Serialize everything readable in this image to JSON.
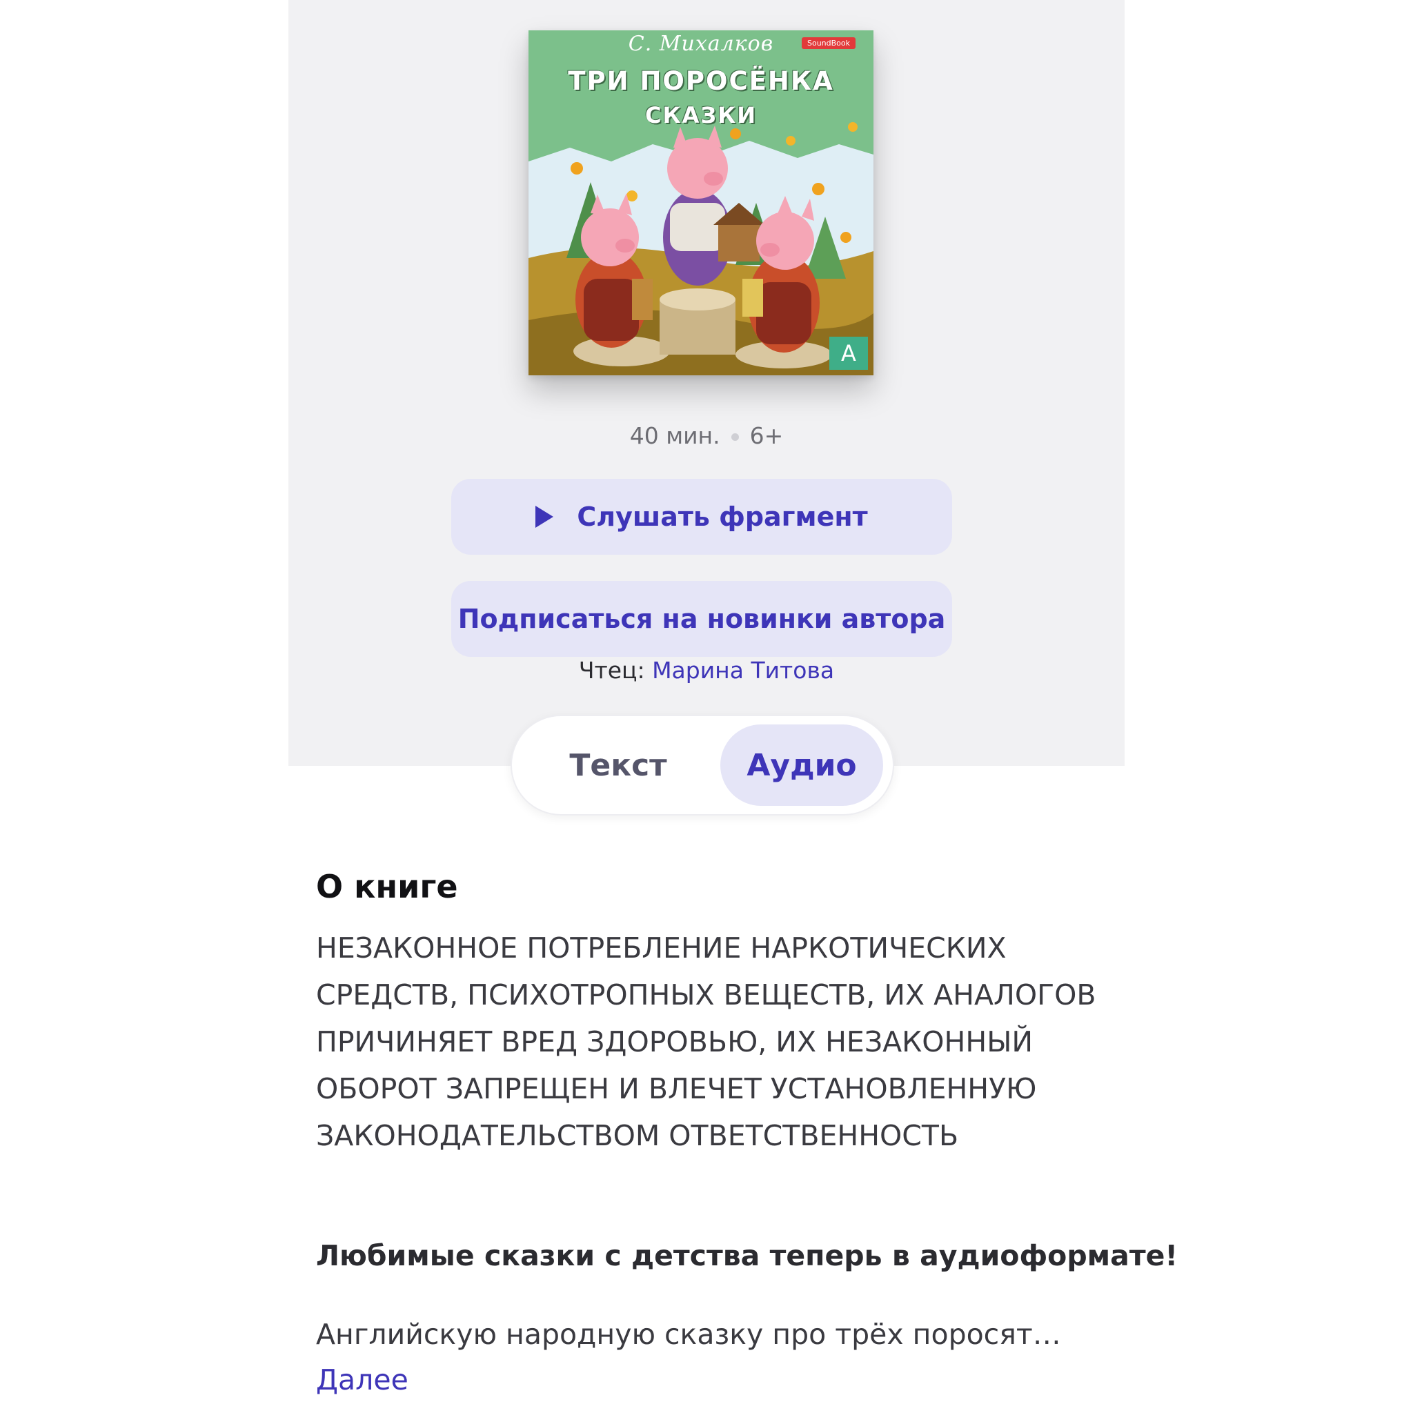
{
  "cover": {
    "author": "С. Михалков",
    "publisher": "SoundBook",
    "title": "ТРИ ПОРОСЁНКА",
    "subtitle": "СКАЗКИ",
    "corner_mark": "А"
  },
  "meta": {
    "duration": "40 мин.",
    "age_rating": "6+"
  },
  "actions": {
    "listen_label": "Слушать фрагмент",
    "subscribe_label": "Подписаться на новинки автора"
  },
  "reader": {
    "label": "Чтец:",
    "name": "Марина Титова"
  },
  "format_tabs": {
    "text_label": "Текст",
    "audio_label": "Аудио",
    "selected": "Аудио"
  },
  "about": {
    "heading": "О книге",
    "warning": "НЕЗАКОННОЕ ПОТРЕБЛЕНИЕ НАРКОТИЧЕСКИХ СРЕДСТВ, ПСИХОТРОПНЫХ ВЕЩЕСТВ, ИХ АНАЛОГОВ ПРИЧИНЯЕТ ВРЕД ЗДОРОВЬЮ, ИХ НЕЗАКОННЫЙ ОБОРОТ ЗАПРЕЩЕН И ВЛЕЧЕТ УСТАНОВЛЕННУЮ ЗАКОНОДАТЕЛЬСТВОМ ОТВЕТСТВЕННОСТЬ",
    "tagline": "Любимые сказки с детства теперь в аудиоформате!",
    "description": "Английскую народную сказку про трёх поросят…",
    "more_label": "Далее"
  },
  "colors": {
    "accent": "#3e35b8",
    "button_bg": "#e5e5f7",
    "hero_bg": "#f1f1f3"
  }
}
